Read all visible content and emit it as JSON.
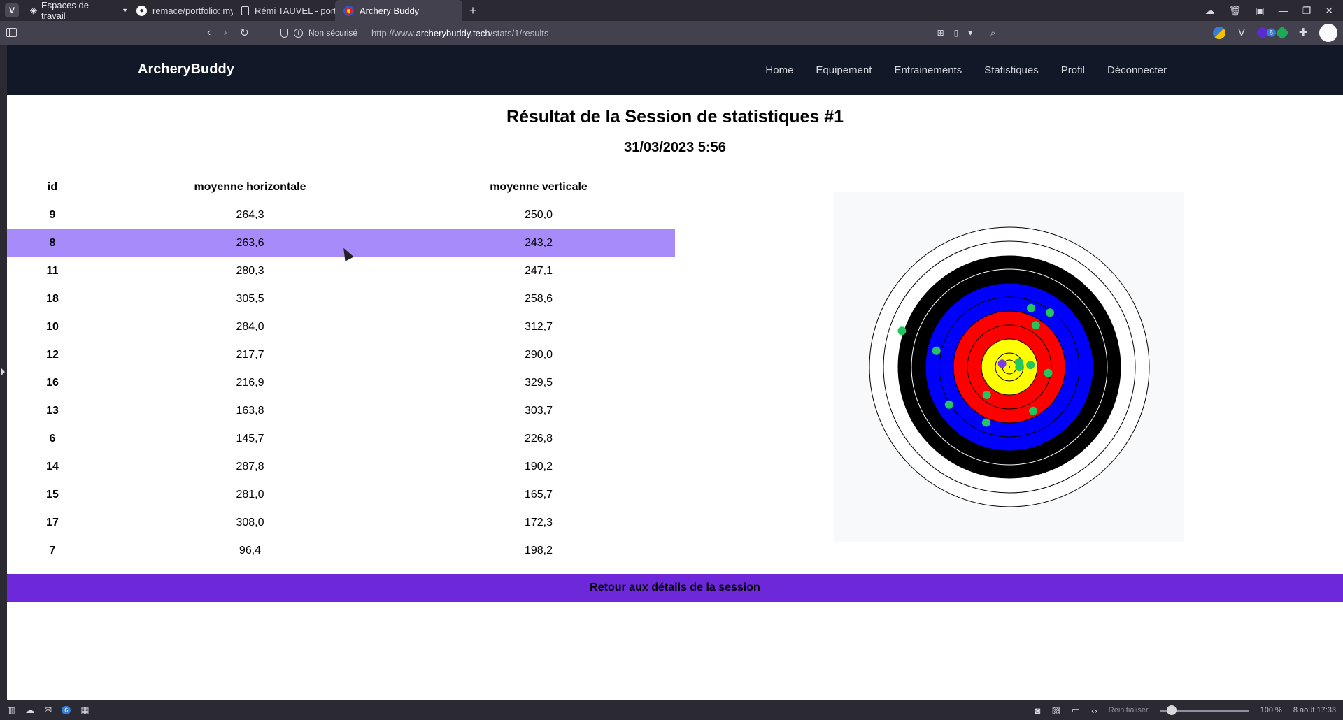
{
  "browser": {
    "workspaces_label": "Espaces de travail",
    "tabs": [
      {
        "title": "remace/portfolio: my w...",
        "active": false
      },
      {
        "title": "Rémi TAUVEL - portfolio",
        "active": false
      },
      {
        "title": "Archery Buddy",
        "active": true
      }
    ],
    "new_tab": "+",
    "security_label": "Non sécurisé",
    "url_prefix": "http://www.",
    "url_host": "archerybuddy.tech",
    "url_path": "/stats/1/results",
    "extension_badge": "6"
  },
  "site": {
    "brand": "ArcheryBuddy",
    "menu": [
      "Home",
      "Equipement",
      "Entrainements",
      "Statistiques",
      "Profil",
      "Déconnecter"
    ]
  },
  "page": {
    "title": "Résultat de la Session de statistiques #1",
    "date": "31/03/2023 5:56",
    "back_button": "Retour aux détails de la session"
  },
  "table": {
    "headers": [
      "id",
      "moyenne horizontale",
      "moyenne verticale"
    ],
    "highlighted_id": "8",
    "rows": [
      {
        "id": "9",
        "h": "264,3",
        "v": "250,0"
      },
      {
        "id": "8",
        "h": "263,6",
        "v": "243,2"
      },
      {
        "id": "11",
        "h": "280,3",
        "v": "247,1"
      },
      {
        "id": "18",
        "h": "305,5",
        "v": "258,6"
      },
      {
        "id": "10",
        "h": "284,0",
        "v": "312,7"
      },
      {
        "id": "12",
        "h": "217,7",
        "v": "290,0"
      },
      {
        "id": "16",
        "h": "216,9",
        "v": "329,5"
      },
      {
        "id": "13",
        "h": "163,8",
        "v": "303,7"
      },
      {
        "id": "6",
        "h": "145,7",
        "v": "226,8"
      },
      {
        "id": "14",
        "h": "287,8",
        "v": "190,2"
      },
      {
        "id": "15",
        "h": "281,0",
        "v": "165,7"
      },
      {
        "id": "17",
        "h": "308,0",
        "v": "172,3"
      },
      {
        "id": "7",
        "h": "96,4",
        "v": "198,2"
      }
    ]
  },
  "target": {
    "colors": {
      "white": "#ffffff",
      "black": "#000000",
      "blue": "#0000ff",
      "red": "#ff0000",
      "yellow": "#ffff00",
      "arrow": "#22c55e",
      "center_mark": "#7c3aed",
      "panel": "#f8f9fa"
    },
    "zone_count": 10,
    "arrows": [
      {
        "x": 264.3,
        "y": 250.0
      },
      {
        "x": 263.6,
        "y": 243.2
      },
      {
        "x": 280.3,
        "y": 247.1
      },
      {
        "x": 305.5,
        "y": 258.6
      },
      {
        "x": 284.0,
        "y": 312.7
      },
      {
        "x": 217.7,
        "y": 290.0
      },
      {
        "x": 216.9,
        "y": 329.5
      },
      {
        "x": 163.8,
        "y": 303.7
      },
      {
        "x": 145.7,
        "y": 226.8
      },
      {
        "x": 287.8,
        "y": 190.2
      },
      {
        "x": 281.0,
        "y": 165.7
      },
      {
        "x": 308.0,
        "y": 172.3
      },
      {
        "x": 96.4,
        "y": 198.2
      }
    ]
  },
  "statusbar": {
    "mail_count": "6",
    "reset_label": "Réinitialiser",
    "zoom": "100 %",
    "zoom_value": 1.0,
    "datetime": "8 août 17:33"
  }
}
